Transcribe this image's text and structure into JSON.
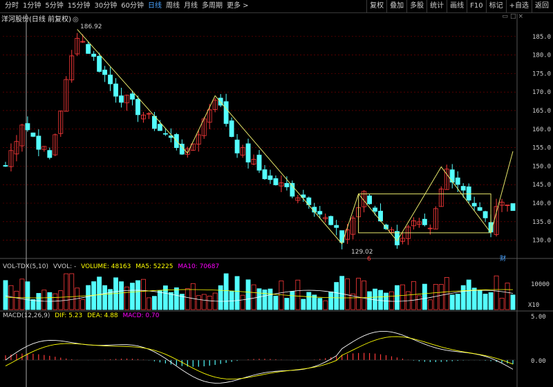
{
  "toolbar": {
    "periods": [
      {
        "label": "分时",
        "active": false
      },
      {
        "label": "1分钟",
        "active": false
      },
      {
        "label": "5分钟",
        "active": false
      },
      {
        "label": "15分钟",
        "active": false
      },
      {
        "label": "30分钟",
        "active": false
      },
      {
        "label": "60分钟",
        "active": false
      },
      {
        "label": "日线",
        "active": true
      },
      {
        "label": "周线",
        "active": false
      },
      {
        "label": "月线",
        "active": false
      },
      {
        "label": "多周期",
        "active": false
      },
      {
        "label": "更多 >",
        "active": false
      }
    ],
    "tools": [
      "复权",
      "叠加",
      "多股",
      "统计",
      "画线",
      "F10",
      "标记",
      "+自选",
      "返回"
    ]
  },
  "title": "洋河股份(日线 前复权)",
  "colors": {
    "up": "#ff3b3b",
    "down": "#54ffff",
    "ma5": "#ffffff",
    "ma10": "#ffff00",
    "ma20": "#ff00ff",
    "drawing": "#e6e66a",
    "grid": "#8b0000",
    "axis": "#d0d0d0"
  },
  "price_axis": {
    "ticks": [
      "185.0",
      "180.0",
      "175.0",
      "170.0",
      "165.0",
      "160.0",
      "155.0",
      "150.0",
      "145.0",
      "140.0",
      "135.0",
      "130.0"
    ],
    "min": 127.5,
    "max": 188.5
  },
  "annotations": {
    "high_label": "186.92",
    "low_label": "129.02",
    "event_marker_1": "6",
    "event_marker_2": "财"
  },
  "volume": {
    "legend": {
      "name": "VOL-TDX(5,10)",
      "vvol": "VVOL: -",
      "volume": "VOLUME: 48163",
      "ma5": "MA5: 52225",
      "ma10": "MA10: 70687"
    },
    "axis": {
      "tick": "10000",
      "unit": "X10"
    }
  },
  "macd": {
    "legend": {
      "name": "MACD(12,26,9)",
      "dif": "DIF: 5.23",
      "dea": "DEA: 4.88",
      "macd": "MACD: 0.70"
    },
    "axis": {
      "top": "5.00",
      "mid": "0.00"
    }
  },
  "chart_data": {
    "type": "candlestick",
    "candle_count": 93,
    "key_closes": [
      {
        "index": 0,
        "close": 150.0
      },
      {
        "index": 3,
        "close": 162.0
      },
      {
        "index": 8,
        "close": 152.0
      },
      {
        "index": 13,
        "close": 186.0
      },
      {
        "index": 16,
        "close": 179.0
      },
      {
        "index": 20,
        "close": 170.0
      },
      {
        "index": 25,
        "close": 164.0
      },
      {
        "index": 33,
        "close": 153.0
      },
      {
        "index": 38,
        "close": 169.0
      },
      {
        "index": 42,
        "close": 155.0
      },
      {
        "index": 48,
        "close": 146.0
      },
      {
        "index": 55,
        "close": 141.0
      },
      {
        "index": 61,
        "close": 130.0
      },
      {
        "index": 65,
        "close": 142.0
      },
      {
        "index": 71,
        "close": 130.0
      },
      {
        "index": 74,
        "close": 134.0
      },
      {
        "index": 77,
        "close": 132.0
      },
      {
        "index": 80,
        "close": 149.0
      },
      {
        "index": 83,
        "close": 144.0
      },
      {
        "index": 88,
        "close": 133.0
      },
      {
        "index": 90,
        "close": 142.0
      },
      {
        "index": 92,
        "close": 138.0
      }
    ],
    "high": 186.92,
    "low": 129.02,
    "trend_lines": [
      {
        "points": [
          [
            13,
            186.92
          ],
          [
            33,
            153.5
          ],
          [
            38,
            169.0
          ],
          [
            61,
            129.02
          ],
          [
            64,
            142.5
          ],
          [
            71,
            129.8
          ],
          [
            79,
            149.8
          ],
          [
            88,
            132.0
          ],
          [
            92,
            154.0
          ]
        ]
      }
    ],
    "channel_box": {
      "from_index": 64,
      "to_index": 88,
      "top": 142.5,
      "bottom": 132.0
    },
    "xlim": [
      0,
      93
    ],
    "ylim": [
      127.5,
      188.5
    ]
  }
}
